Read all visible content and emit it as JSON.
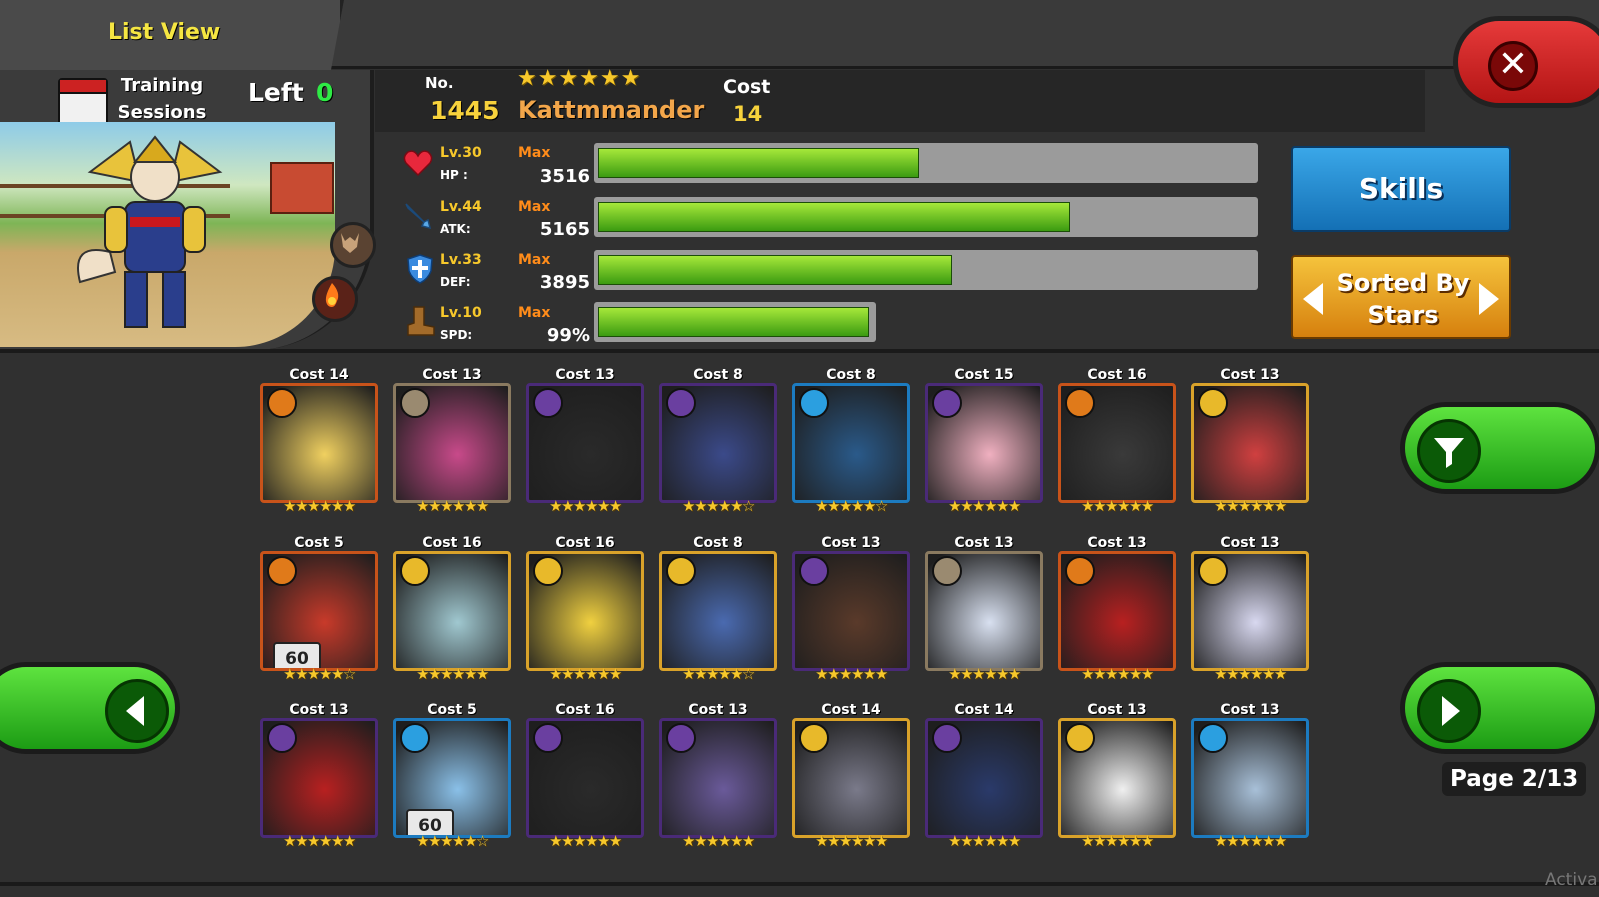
{
  "header": {
    "title": "List View",
    "close_icon": "close-icon"
  },
  "training": {
    "label": "Training Sessions",
    "left_label": "Left",
    "left_value": "0"
  },
  "monster": {
    "no_label": "No.",
    "no_value": "1445",
    "stars": "★★★★★★",
    "name": "Kattmmander",
    "cost_label": "Cost",
    "cost_value": "14",
    "elements": [
      "beast-element-icon",
      "fire-element-icon"
    ]
  },
  "stats": [
    {
      "icon": "heart-icon",
      "level": "Lv.30",
      "name": "HP :",
      "max": "Max",
      "value": "3516",
      "fill": 0.49
    },
    {
      "icon": "sword-icon",
      "level": "Lv.44",
      "name": "ATK:",
      "max": "Max",
      "value": "5165",
      "fill": 0.72
    },
    {
      "icon": "shield-icon",
      "level": "Lv.33",
      "name": "DEF:",
      "max": "Max",
      "value": "3895",
      "fill": 0.54
    },
    {
      "icon": "boot-icon",
      "level": "Lv.10",
      "name": "SPD:",
      "max": "Max",
      "value": "99%",
      "fill": 0.99
    }
  ],
  "buttons": {
    "skills": "Skills",
    "sort": "Sorted By Stars"
  },
  "colors": {
    "accent_green": "#3bbd1f",
    "hp_red": "#e8283c",
    "gold": "#f7c82b"
  },
  "cards": [
    [
      {
        "cost": "Cost 14",
        "element": "fire",
        "stars": 6,
        "badge": ""
      },
      {
        "cost": "Cost 13",
        "element": "neutral",
        "stars": 6,
        "badge": ""
      },
      {
        "cost": "Cost 13",
        "element": "dark",
        "stars": 6,
        "badge": ""
      },
      {
        "cost": "Cost 8",
        "element": "dark",
        "stars": 5,
        "badge": ""
      },
      {
        "cost": "Cost 8",
        "element": "water",
        "stars": 5,
        "badge": ""
      },
      {
        "cost": "Cost 15",
        "element": "dark",
        "stars": 6,
        "badge": ""
      },
      {
        "cost": "Cost 16",
        "element": "fire",
        "stars": 6,
        "badge": ""
      },
      {
        "cost": "Cost 13",
        "element": "light",
        "stars": 6,
        "badge": ""
      }
    ],
    [
      {
        "cost": "Cost 5",
        "element": "fire",
        "stars": 5,
        "badge": "60"
      },
      {
        "cost": "Cost 16",
        "element": "light",
        "stars": 6,
        "badge": ""
      },
      {
        "cost": "Cost 16",
        "element": "light",
        "stars": 6,
        "badge": ""
      },
      {
        "cost": "Cost 8",
        "element": "light",
        "stars": 5,
        "badge": ""
      },
      {
        "cost": "Cost 13",
        "element": "dark",
        "stars": 6,
        "badge": ""
      },
      {
        "cost": "Cost 13",
        "element": "neutral",
        "stars": 6,
        "badge": ""
      },
      {
        "cost": "Cost 13",
        "element": "fire",
        "stars": 6,
        "badge": ""
      },
      {
        "cost": "Cost 13",
        "element": "light",
        "stars": 6,
        "badge": ""
      }
    ],
    [
      {
        "cost": "Cost 13",
        "element": "dark",
        "stars": 6,
        "badge": ""
      },
      {
        "cost": "Cost 5",
        "element": "water",
        "stars": 5,
        "badge": "60"
      },
      {
        "cost": "Cost 16",
        "element": "dark",
        "stars": 6,
        "badge": ""
      },
      {
        "cost": "Cost 13",
        "element": "dark",
        "stars": 6,
        "badge": ""
      },
      {
        "cost": "Cost 14",
        "element": "light",
        "stars": 6,
        "badge": ""
      },
      {
        "cost": "Cost 14",
        "element": "dark",
        "stars": 6,
        "badge": ""
      },
      {
        "cost": "Cost 13",
        "element": "light",
        "stars": 6,
        "badge": ""
      },
      {
        "cost": "Cost 13",
        "element": "water",
        "stars": 6,
        "badge": ""
      }
    ]
  ],
  "pagination": {
    "label": "Page 2/13",
    "prev_icon": "left-arrow-icon",
    "next_icon": "right-arrow-icon",
    "filter_icon": "filter-icon"
  },
  "watermark": "Activa"
}
